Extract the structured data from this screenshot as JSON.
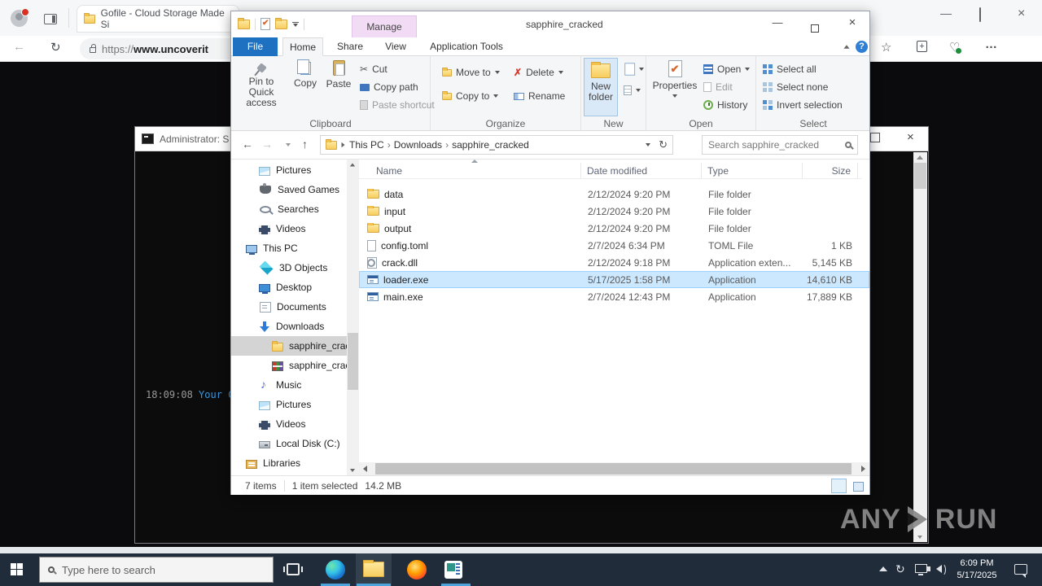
{
  "browser": {
    "tab_title": "Gofile - Cloud Storage Made Si",
    "url_scheme": "https://",
    "url_host": "www.uncoverit",
    "menu_dots": "…"
  },
  "console": {
    "title": "Administrator: S",
    "log_time": "18:09:08",
    "log_message": "Your C"
  },
  "explorer": {
    "window_title": "sapphire_cracked",
    "manage_label": "Manage",
    "tabs": [
      "File",
      "Home",
      "Share",
      "View",
      "Application Tools"
    ],
    "ribbon": {
      "group_labels": [
        "Clipboard",
        "Organize",
        "New",
        "Open",
        "Select"
      ],
      "pin": "Pin to Quick access",
      "copy": "Copy",
      "paste": "Paste",
      "cut": "Cut",
      "copy_path": "Copy path",
      "paste_shortcut": "Paste shortcut",
      "move_to": "Move to",
      "copy_to": "Copy to",
      "delete": "Delete",
      "rename": "Rename",
      "new_folder": "New folder",
      "properties": "Properties",
      "open": "Open",
      "edit": "Edit",
      "history": "History",
      "select_all": "Select all",
      "select_none": "Select none",
      "invert_selection": "Invert selection"
    },
    "address": {
      "crumbs": [
        "This PC",
        "Downloads",
        "sapphire_cracked"
      ],
      "search_placeholder": "Search sapphire_cracked"
    },
    "sidebar": [
      {
        "label": "Pictures",
        "icon": "pictures",
        "level": 1
      },
      {
        "label": "Saved Games",
        "icon": "saved-games",
        "level": 1
      },
      {
        "label": "Searches",
        "icon": "searches",
        "level": 1
      },
      {
        "label": "Videos",
        "icon": "videos",
        "level": 1
      },
      {
        "label": "This PC",
        "icon": "this-pc",
        "level": 0
      },
      {
        "label": "3D Objects",
        "icon": "3d",
        "level": 1
      },
      {
        "label": "Desktop",
        "icon": "desktop",
        "level": 1
      },
      {
        "label": "Documents",
        "icon": "documents",
        "level": 1
      },
      {
        "label": "Downloads",
        "icon": "downloads",
        "level": 1
      },
      {
        "label": "sapphire_crac",
        "icon": "folder",
        "level": 2,
        "selected": true
      },
      {
        "label": "sapphire_crac",
        "icon": "winrar",
        "level": 2
      },
      {
        "label": "Music",
        "icon": "music",
        "level": 1
      },
      {
        "label": "Pictures",
        "icon": "pictures",
        "level": 1
      },
      {
        "label": "Videos",
        "icon": "videos",
        "level": 1
      },
      {
        "label": "Local Disk (C:)",
        "icon": "disk",
        "level": 1
      },
      {
        "label": "Libraries",
        "icon": "libraries",
        "level": 0
      }
    ],
    "files": {
      "headers": [
        "Name",
        "Date modified",
        "Type",
        "Size"
      ],
      "rows": [
        {
          "name": "data",
          "icon": "folder",
          "date": "2/12/2024 9:20 PM",
          "type": "File folder",
          "size": ""
        },
        {
          "name": "input",
          "icon": "folder",
          "date": "2/12/2024 9:20 PM",
          "type": "File folder",
          "size": ""
        },
        {
          "name": "output",
          "icon": "folder",
          "date": "2/12/2024 9:20 PM",
          "type": "File folder",
          "size": ""
        },
        {
          "name": "config.toml",
          "icon": "file",
          "date": "2/7/2024 6:34 PM",
          "type": "TOML File",
          "size": "1 KB"
        },
        {
          "name": "crack.dll",
          "icon": "dll",
          "date": "2/12/2024 9:18 PM",
          "type": "Application exten...",
          "size": "5,145 KB"
        },
        {
          "name": "loader.exe",
          "icon": "exe",
          "date": "5/17/2025 1:58 PM",
          "type": "Application",
          "size": "14,610 KB",
          "selected": true
        },
        {
          "name": "main.exe",
          "icon": "exe",
          "date": "2/7/2024 12:43 PM",
          "type": "Application",
          "size": "17,889 KB"
        }
      ]
    },
    "status": {
      "count": "7 items",
      "selected": "1 item selected",
      "size": "14.2 MB"
    }
  },
  "taskbar": {
    "search_placeholder": "Type here to search",
    "clock_time": "6:09 PM",
    "clock_date": "5/17/2025"
  },
  "watermark": {
    "left": "ANY",
    "right": "RUN"
  },
  "colors": {
    "selection_blue": "#cce8ff",
    "selection_border": "#99d1ff",
    "file_tab_blue": "#1e70c1",
    "manage_pink": "#f2dcf5",
    "taskbar_dark": "#202c3a",
    "taskbar_underline": "#4da3dd",
    "sidebar_selection_gray": "#d4d4d4",
    "console_log_blue": "#3a96dd"
  }
}
